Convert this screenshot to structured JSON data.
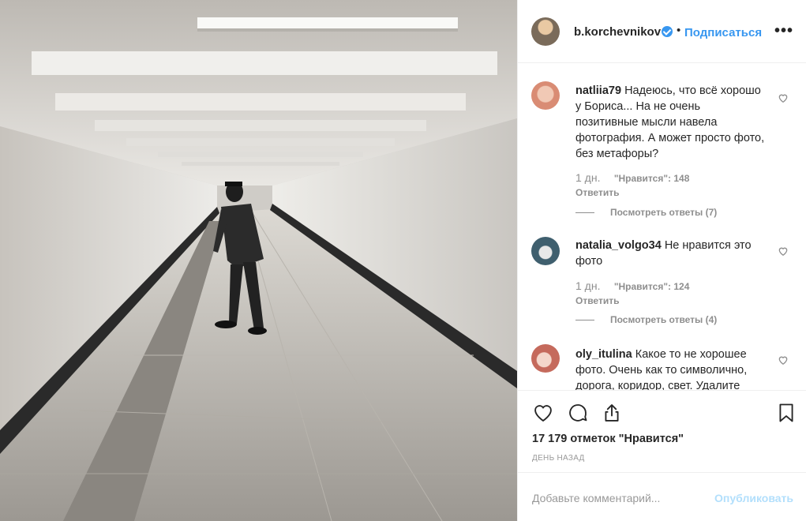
{
  "post": {
    "username": "b.korchevnikov",
    "separator": "•",
    "follow_label": "Подписаться",
    "more_label": "•••",
    "likes_text": "17 179 отметок \"Нравится\"",
    "date_text": "ДЕНЬ НАЗАД"
  },
  "comments": [
    {
      "username": "natliia79",
      "text": "Надеюсь, что всё хорошо у Бориса... На не очень позитивные мысли навела фотография. А может просто фото, без метафоры?",
      "age": "1 дн.",
      "likes": "\"Нравится\": 148",
      "reply": "Ответить",
      "view_replies": "Посмотреть ответы (7)"
    },
    {
      "username": "natalia_volgo34",
      "text": "Не нравится это фото",
      "age": "1 дн.",
      "likes": "\"Нравится\": 124",
      "reply": "Ответить",
      "view_replies": "Посмотреть ответы (4)"
    },
    {
      "username": "oly_itulina",
      "text": "Какое то не хорошее фото. Очень как то символично, дорога, коридор, свет. Удалите"
    }
  ],
  "add_comment": {
    "placeholder": "Добавьте комментарий...",
    "publish_label": "Опубликовать"
  },
  "colors": {
    "accent": "#3897f0",
    "publish_disabled": "#b2dffc",
    "secondary_text": "#8e8e8e"
  },
  "icons": [
    "heart-icon",
    "comment-icon",
    "share-icon",
    "bookmark-icon",
    "verified-icon",
    "more-options-icon"
  ]
}
